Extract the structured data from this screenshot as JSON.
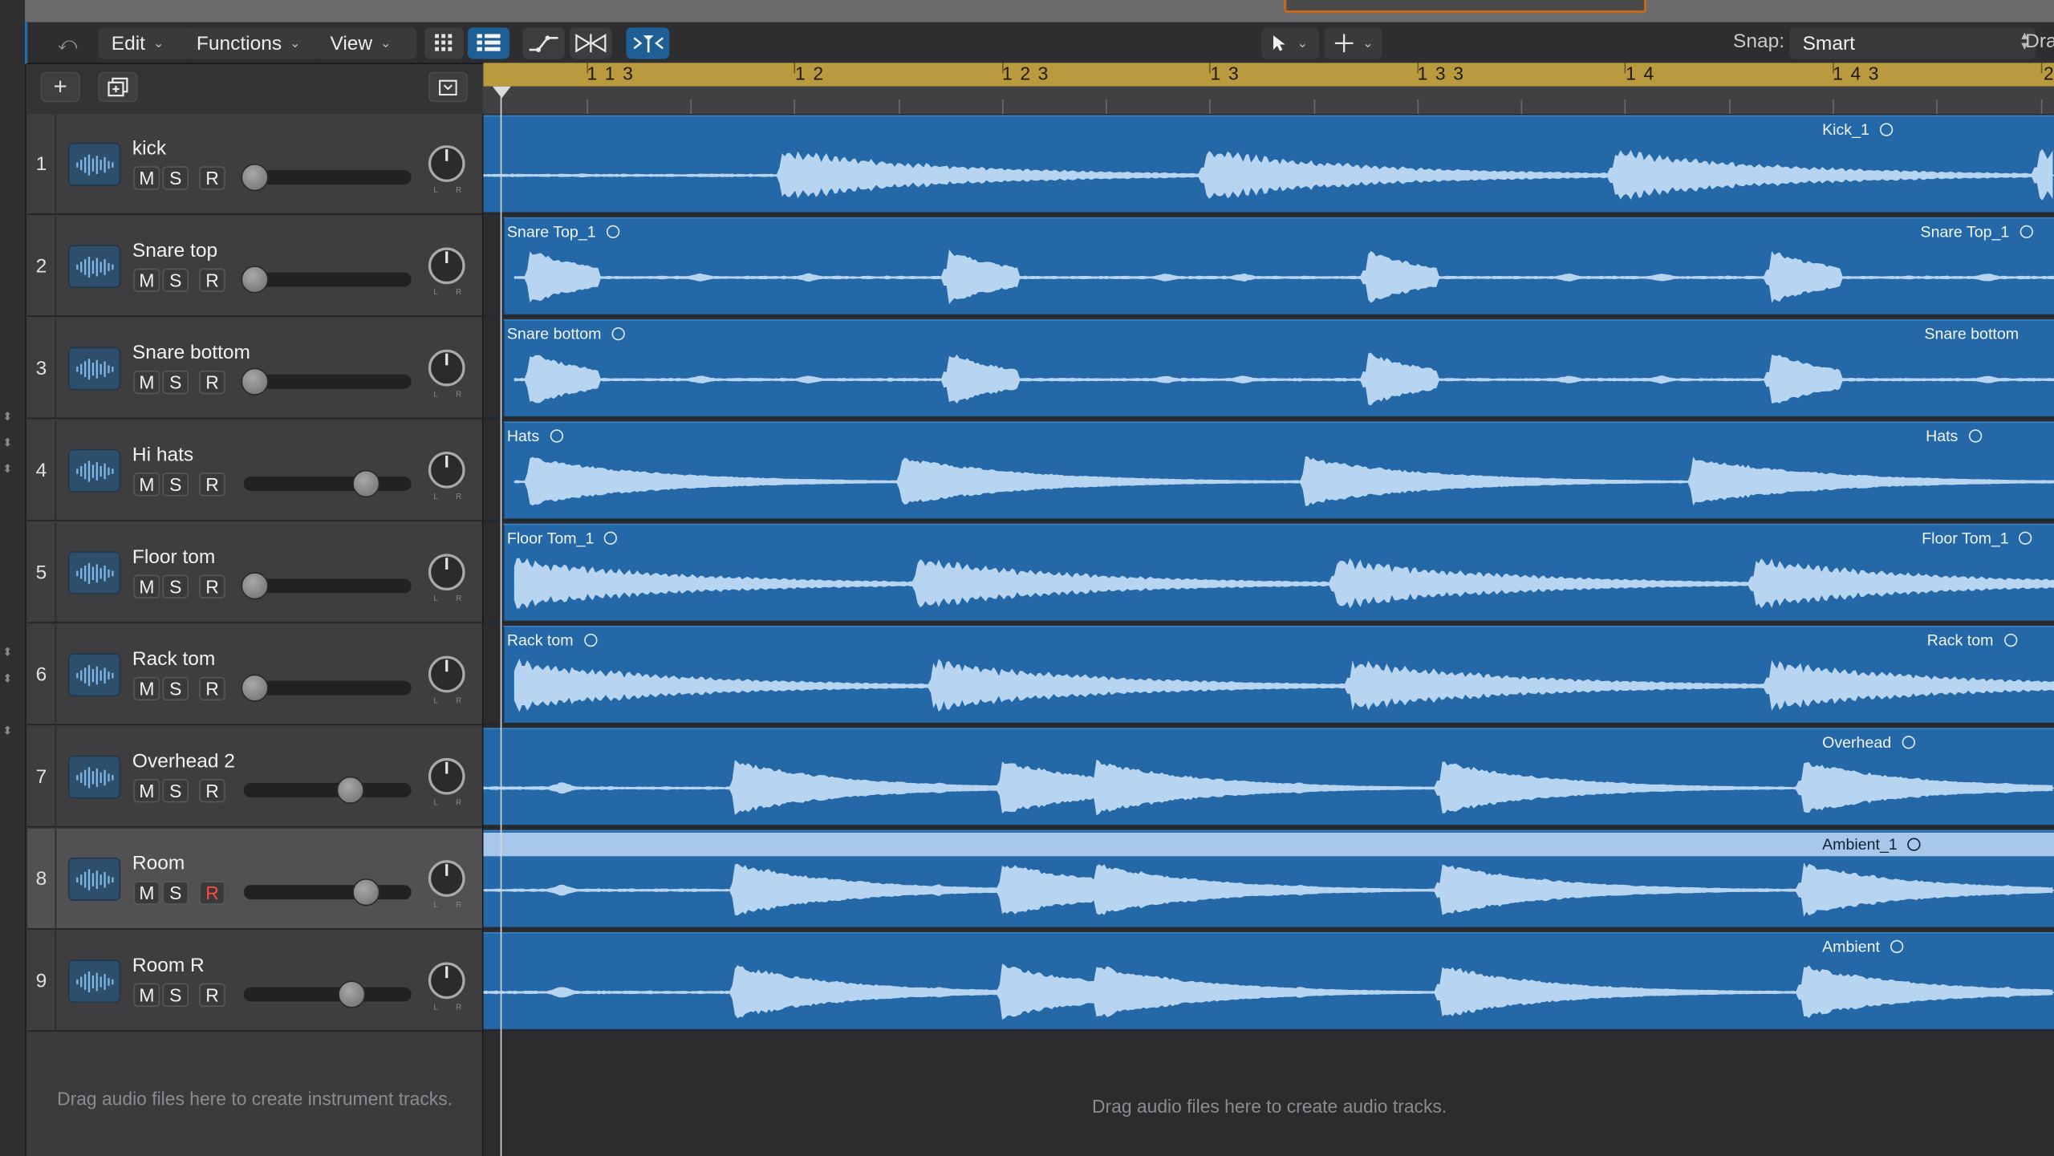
{
  "toolbar": {
    "edit_menu": "Edit",
    "functions_menu": "Functions",
    "view_menu": "View",
    "snap_label": "Snap:",
    "snap_value": "Smart",
    "drag_label": "Dra"
  },
  "ruler": {
    "labels": [
      "1 1 3",
      "1 2",
      "1 2 3",
      "1 3",
      "1 3 3",
      "1 4",
      "1 4 3",
      "2"
    ]
  },
  "tracks": [
    {
      "number": "1",
      "name": "kick",
      "mute": "M",
      "solo": "S",
      "record": "R"
    },
    {
      "number": "2",
      "name": "Snare top",
      "mute": "M",
      "solo": "S",
      "record": "R"
    },
    {
      "number": "3",
      "name": "Snare bottom",
      "mute": "M",
      "solo": "S",
      "record": "R"
    },
    {
      "number": "4",
      "name": "Hi hats",
      "mute": "M",
      "solo": "S",
      "record": "R"
    },
    {
      "number": "5",
      "name": "Floor tom",
      "mute": "M",
      "solo": "S",
      "record": "R"
    },
    {
      "number": "6",
      "name": "Rack tom",
      "mute": "M",
      "solo": "S",
      "record": "R"
    },
    {
      "number": "7",
      "name": "Overhead 2",
      "mute": "M",
      "solo": "S",
      "record": "R"
    },
    {
      "number": "8",
      "name": "Room",
      "mute": "M",
      "solo": "S",
      "record": "R"
    },
    {
      "number": "9",
      "name": "Room R",
      "mute": "M",
      "solo": "S",
      "record": "R"
    }
  ],
  "volume": [
    0.0,
    0.0,
    0.0,
    0.72,
    0.0,
    0.0,
    0.62,
    0.72,
    0.63
  ],
  "regions": [
    {
      "right": "Kick_1"
    },
    {
      "left": "Snare Top_1",
      "right": "Snare Top_1"
    },
    {
      "left": "Snare bottom",
      "right": "Snare bottom"
    },
    {
      "left": "Hats",
      "right": "Hats"
    },
    {
      "left": "Floor Tom_1",
      "right": "Floor Tom_1"
    },
    {
      "left": "Rack tom",
      "right": "Rack tom"
    },
    {
      "right": "Overhead"
    },
    {
      "right": "Ambient_1"
    },
    {
      "right": "Ambient"
    }
  ],
  "empty_instrument_note": "Drag audio files here to create instrument tracks.",
  "empty_audio_note": "Drag audio files here to create audio tracks.",
  "colors": {
    "region": "#2468a8",
    "waveform": "#b7d4f0",
    "ruler": "#b99a3e",
    "record_armed": "#ff4a3d"
  }
}
